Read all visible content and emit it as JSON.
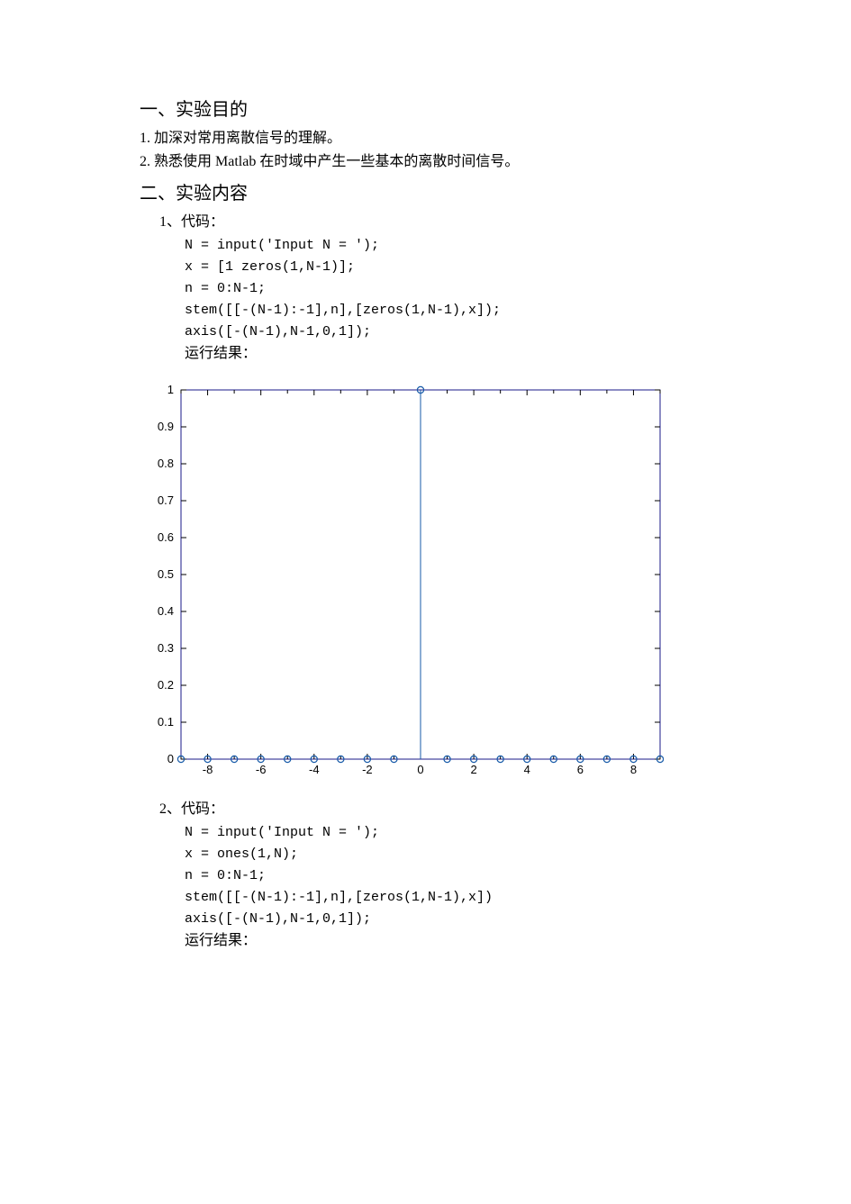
{
  "section1": {
    "heading": "一、实验目的",
    "items": [
      "1. 加深对常用离散信号的理解。",
      "2. 熟悉使用 Matlab 在时域中产生一些基本的离散时间信号。"
    ]
  },
  "section2": {
    "heading": "二、实验内容",
    "block1": {
      "head": "1、代码：",
      "code": [
        "N = input('Input N = ');",
        "x = [1 zeros(1,N-1)];",
        "n = 0:N-1;",
        "stem([[-(N-1):-1],n],[zeros(1,N-1),x]);",
        "axis([-(N-1),N-1,0,1]);"
      ],
      "run_label": "运行结果："
    },
    "block2": {
      "head": "2、代码：",
      "code": [
        "N = input('Input N = ');",
        "x = ones(1,N);",
        "n = 0:N-1;",
        "stem([[-(N-1):-1],n],[zeros(1,N-1),x])",
        "axis([-(N-1),N-1,0,1]);"
      ],
      "run_label": "运行结果："
    }
  },
  "chart_data": {
    "type": "bar",
    "title": "",
    "xlabel": "",
    "ylabel": "",
    "xlim": [
      -9,
      9
    ],
    "ylim": [
      0,
      1
    ],
    "x_ticks": [
      -8,
      -6,
      -4,
      -2,
      0,
      2,
      4,
      6,
      8
    ],
    "y_ticks": [
      0,
      0.1,
      0.2,
      0.3,
      0.4,
      0.5,
      0.6,
      0.7,
      0.8,
      0.9,
      1
    ],
    "categories": [
      -9,
      -8,
      -7,
      -6,
      -5,
      -4,
      -3,
      -2,
      -1,
      0,
      1,
      2,
      3,
      4,
      5,
      6,
      7,
      8,
      9
    ],
    "values": [
      0,
      0,
      0,
      0,
      0,
      0,
      0,
      0,
      0,
      1,
      0,
      0,
      0,
      0,
      0,
      0,
      0,
      0,
      0
    ]
  }
}
